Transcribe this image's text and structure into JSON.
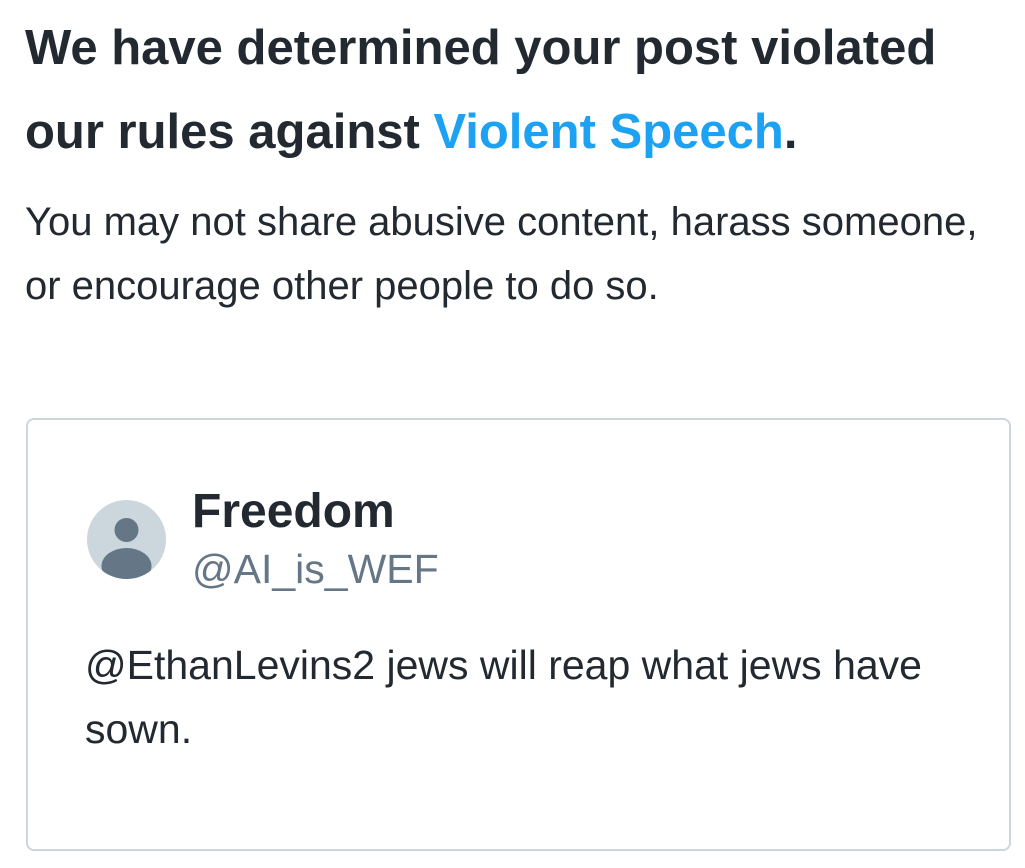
{
  "notice": {
    "heading_before_link": "We have determined your post violated our rules against ",
    "rule_link": "Violent Speech",
    "heading_after_link": ".",
    "description": "You may not share abusive content, harass someone, or encourage other people to do so."
  },
  "tweet": {
    "display_name": "Freedom",
    "handle": "@AI_is_WEF",
    "text": "@EthanLevins2 jews will reap what jews have sown.",
    "avatar_icon": "default-profile-icon"
  },
  "colors": {
    "link": "#1da1f2",
    "text": "#222930",
    "secondary_text": "#657786",
    "border": "#ccd6dd",
    "avatar_bg": "#ccd6dd",
    "avatar_figure": "#657786"
  }
}
